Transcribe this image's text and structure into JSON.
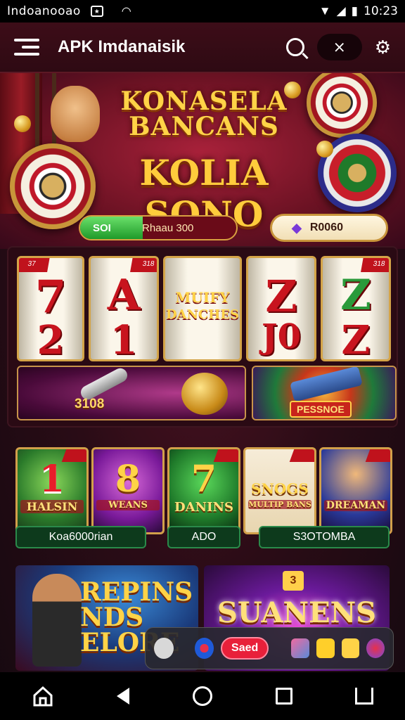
{
  "status_bar": {
    "carrier": "Indoanooao",
    "time": "10:23"
  },
  "app_bar": {
    "title": "APK Imdanaisik"
  },
  "hero": {
    "title_line1": "KONASELA",
    "title_line2": "BANCANS",
    "title_big": "KOLIA SONO",
    "progress_label": "SOI",
    "progress_value": "Rhaau 300",
    "progress_fraction": 0.4,
    "balance_value": "R0060"
  },
  "slots": {
    "reels": [
      {
        "top": "7",
        "bottom": "2",
        "ribbon": "37"
      },
      {
        "top": "A",
        "bottom": "1",
        "ribbon": "318"
      },
      {
        "top": "MUIFY",
        "bottom": "DANCHES",
        "ribbon": ""
      },
      {
        "top": "Z",
        "bottom": "J0",
        "ribbon": ""
      },
      {
        "top": "Z",
        "bottom": "Z",
        "ribbon": "318"
      }
    ],
    "promo_left_amount": "3108",
    "promo_right_label": "PESSNOE"
  },
  "games": {
    "tiles": [
      {
        "big": "1",
        "sub": "HALSIN"
      },
      {
        "big": "8",
        "sub": "WEANS"
      },
      {
        "big": "7",
        "sub": "DANINS"
      },
      {
        "big": "SNOGS",
        "sub": "MULTIP BANS"
      },
      {
        "big": "",
        "sub": "DREAMAN"
      }
    ],
    "name_bars": [
      "Koa6000rian",
      "ADO",
      "S3OTOMBA"
    ]
  },
  "banners": {
    "left_title": "REPINS NDS ELORE",
    "right_title": "SUANENS",
    "right_badge": "3"
  },
  "tray": {
    "pill_label": "Saed"
  },
  "colors": {
    "brand_dark": "#2e0a13",
    "gold": "#ffd347",
    "accent_red": "#c0121c",
    "accent_green": "#1f9a2a"
  }
}
